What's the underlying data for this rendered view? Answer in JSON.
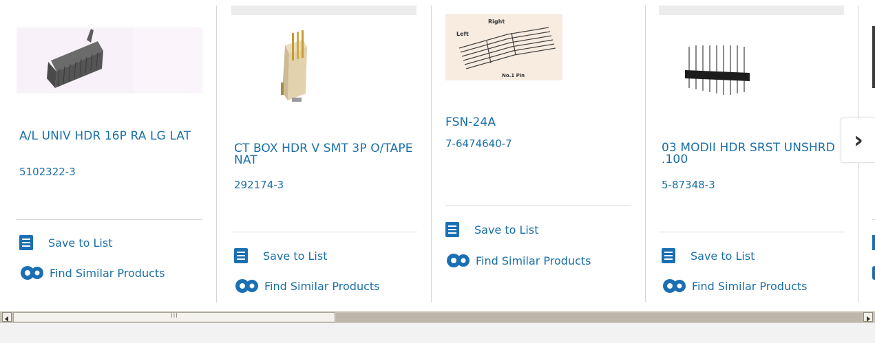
{
  "products": [
    {
      "name": "A/L UNIV HDR 16P RA LG LAT",
      "part_number": "5102322-3",
      "save_label": "Save to List",
      "similar_label": "Find Similar Products"
    },
    {
      "name": "CT BOX HDR V SMT 3P O/TAPE NAT",
      "part_number": "292174-3",
      "save_label": "Save to List",
      "similar_label": "Find Similar Products"
    },
    {
      "name": "FSN-24A",
      "part_number": "7-6474640-7",
      "save_label": "Save to List",
      "similar_label": "Find Similar Products",
      "diagram_labels": {
        "right": "Right",
        "left": "Left",
        "pin": "No.1 Pin"
      }
    },
    {
      "name": "03 MODII HDR SRST UNSHRD .100",
      "part_number": "5-87348-3",
      "save_label": "Save to List",
      "similar_label": "Find Similar Products"
    }
  ],
  "next_button": {
    "icon": "chevron-right-icon",
    "glyph": "›"
  },
  "scrollbar": {
    "thumb_grip": "III"
  },
  "colors": {
    "link": "#1a6fa8",
    "icon": "#1b6fb3"
  }
}
